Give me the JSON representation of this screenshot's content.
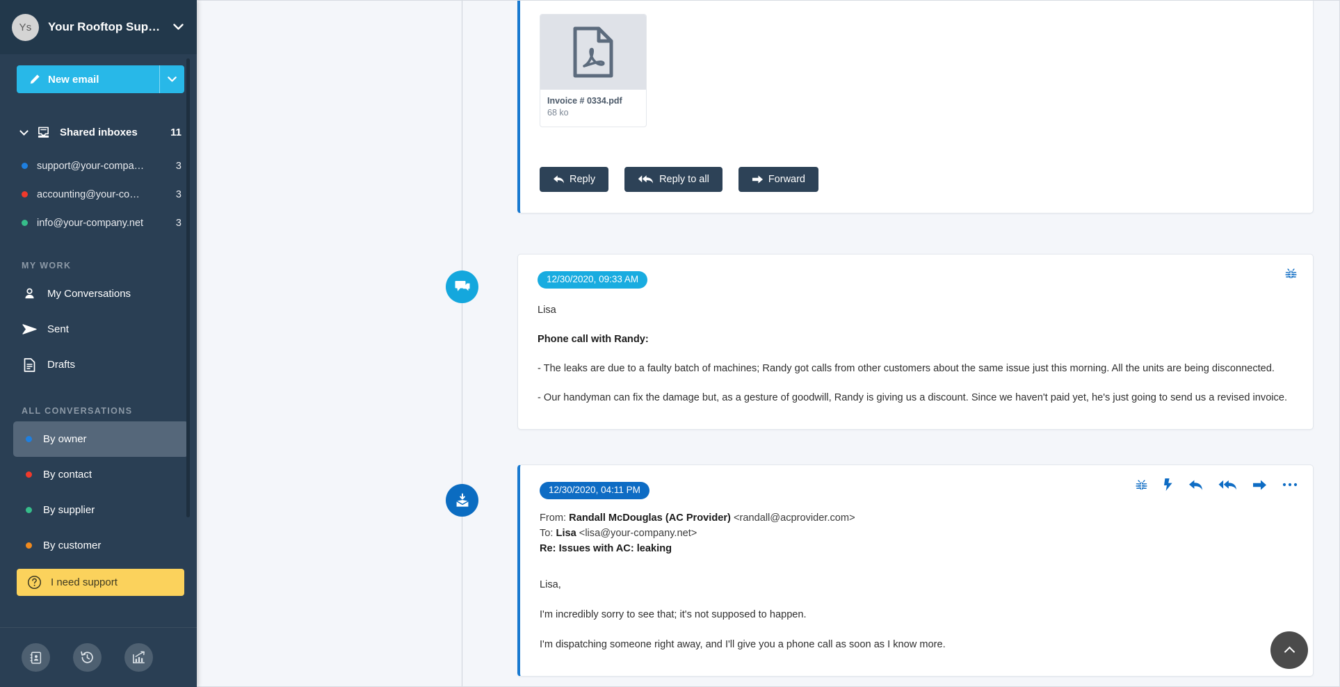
{
  "sidebar": {
    "org": {
      "initials": "Ys",
      "name": "Your Rooftop Support"
    },
    "compose": {
      "label": "New email"
    },
    "shared_inboxes": {
      "label": "Shared inboxes",
      "count": "11",
      "items": [
        {
          "label": "support@your-compa…",
          "count": "3",
          "color": "#1e7fe0"
        },
        {
          "label": "accounting@your-co…",
          "count": "3",
          "color": "#f0392b"
        },
        {
          "label": "info@your-company.net",
          "count": "3",
          "color": "#36bd8a"
        }
      ]
    },
    "my_work": {
      "title": "MY WORK",
      "items": [
        {
          "label": "My Conversations",
          "icon": "user-icon"
        },
        {
          "label": "Sent",
          "icon": "paper-plane-icon"
        },
        {
          "label": "Drafts",
          "icon": "document-icon"
        }
      ]
    },
    "all_conversations": {
      "title": "ALL CONVERSATIONS",
      "items": [
        {
          "label": "By owner",
          "color": "#1e7fe0",
          "active": true
        },
        {
          "label": "By contact",
          "color": "#f0392b",
          "active": false
        },
        {
          "label": "By supplier",
          "color": "#36bd8a",
          "active": false
        },
        {
          "label": "By customer",
          "color": "#f08a1e",
          "active": false
        }
      ]
    },
    "support_button": {
      "label": "I need support"
    },
    "footer_icons": [
      "address-book-icon",
      "history-clock-icon",
      "analytics-chart-icon"
    ]
  },
  "thread": {
    "message_top": {
      "attachment": {
        "name": "Invoice # 0334.pdf",
        "size": "68 ko",
        "type": "pdf"
      },
      "buttons": [
        {
          "label": "Reply",
          "icon": "reply-arrow-icon"
        },
        {
          "label": "Reply to all",
          "icon": "reply-all-arrow-icon"
        },
        {
          "label": "Forward",
          "icon": "forward-arrow-icon"
        }
      ]
    },
    "message_note": {
      "channel_icon": "chat-bubble-icon",
      "timestamp": "12/30/2020, 09:33 AM",
      "author": "Lisa",
      "heading": "Phone call with Randy:",
      "paragraphs": [
        "- The leaks are due to a faulty batch of machines; Randy got calls from other customers about the same issue just this morning. All the units are being disconnected.",
        "- Our handyman can fix the damage but, as a gesture of goodwill, Randy is giving us a discount. Since we haven't paid yet, he's just going to send us a revised invoice."
      ],
      "actions": [
        "bug-icon"
      ]
    },
    "message_email": {
      "channel_icon": "inbox-download-icon",
      "timestamp": "12/30/2020, 04:11 PM",
      "from_label": "From:",
      "from_name": "Randall McDouglas (AC Provider)",
      "from_address": "<randall@acprovider.com>",
      "to_label": "To:",
      "to_name": "Lisa",
      "to_address": "<lisa@your-company.net>",
      "subject": "Re: Issues with AC: leaking",
      "paragraphs": [
        "Lisa,",
        "I'm incredibly sorry to see that; it's not supposed to happen.",
        "I'm dispatching someone right away, and I'll give you a phone call as soon as I know more."
      ],
      "actions": [
        "bug-icon",
        "lightning-bolt-icon",
        "reply-arrow-icon",
        "reply-all-arrow-icon",
        "forward-arrow-icon",
        "ellipsis-icon"
      ]
    }
  },
  "scroll_top_button": {
    "icon": "chevron-up-icon"
  },
  "colors": {
    "sidebar_bg": "#2a3f54",
    "sidebar_header_bg": "#22384b",
    "accent_cyan": "#28b8e8",
    "accent_blue": "#0e6cc4",
    "support_yellow": "#fbd25c",
    "button_dark": "#2d4257",
    "canvas": "#f4f6fa"
  }
}
